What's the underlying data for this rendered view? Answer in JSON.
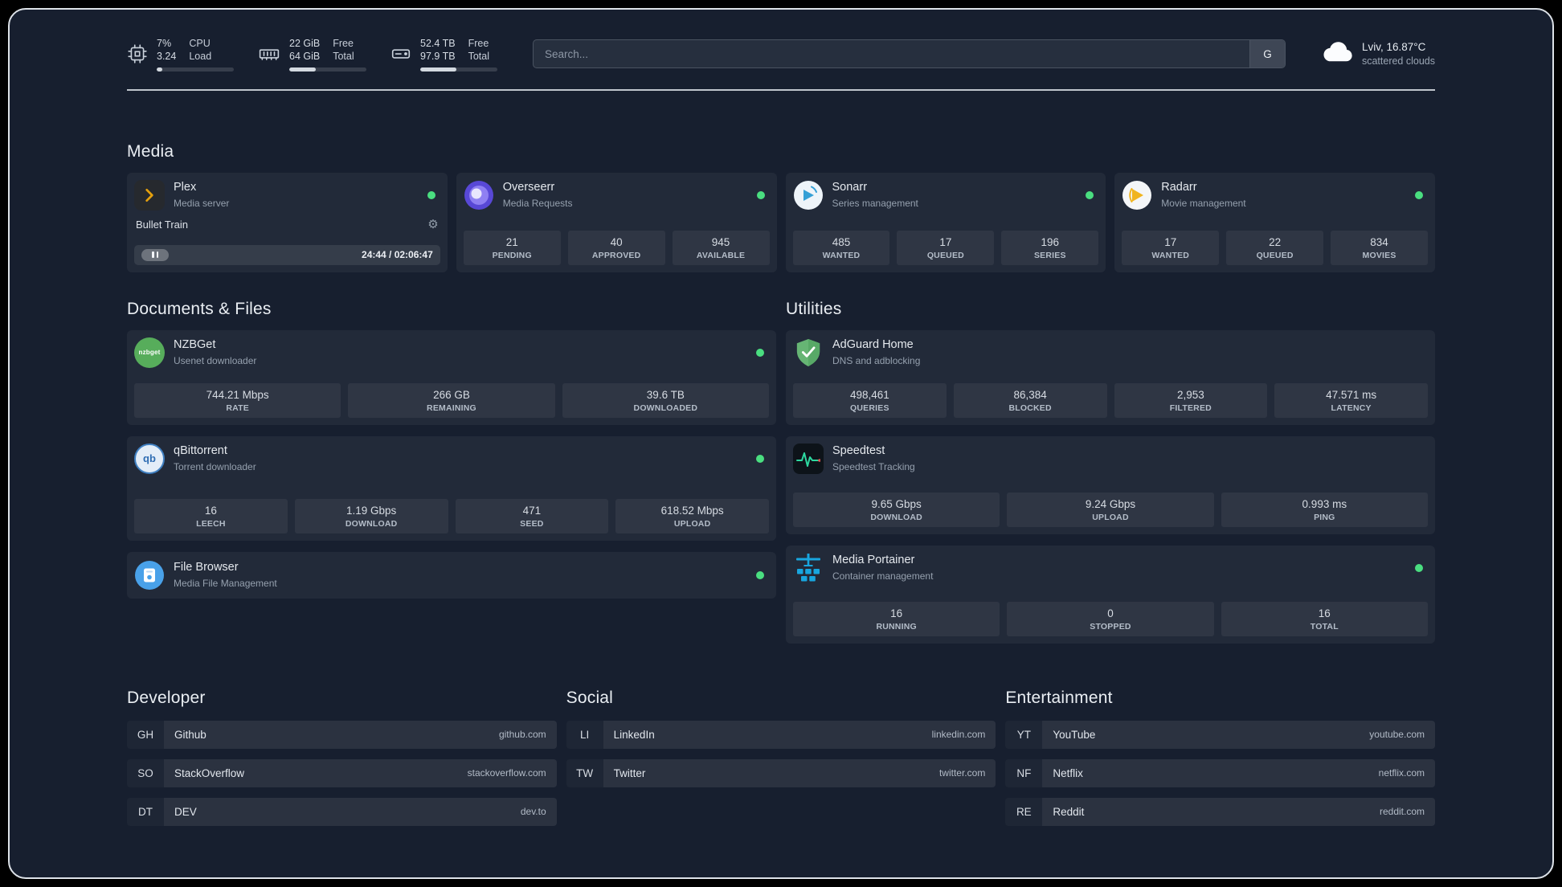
{
  "topbar": {
    "resources": [
      {
        "icon": "cpu-icon",
        "value_top": "7%",
        "value_bottom": "3.24",
        "label_top": "CPU",
        "label_bottom": "Load",
        "progress": "7%"
      },
      {
        "icon": "memory-icon",
        "value_top": "22 GiB",
        "value_bottom": "64 GiB",
        "label_top": "Free",
        "label_bottom": "Total",
        "progress": "34%"
      },
      {
        "icon": "disk-icon",
        "value_top": "52.4 TB",
        "value_bottom": "97.9 TB",
        "label_top": "Free",
        "label_bottom": "Total",
        "progress": "47%"
      }
    ],
    "search": {
      "placeholder": "Search...",
      "provider_button": "G"
    },
    "weather": {
      "location": "Lviv, 16.87°C",
      "condition": "scattered clouds"
    }
  },
  "sections": {
    "media": {
      "title": "Media",
      "plex": {
        "name": "Plex",
        "description": "Media server",
        "status": "online",
        "now_playing": "Bullet Train",
        "progress_time": "24:44 / 02:06:47"
      },
      "overseerr": {
        "name": "Overseerr",
        "description": "Media Requests",
        "status": "online",
        "stats": [
          {
            "value": "21",
            "label": "PENDING"
          },
          {
            "value": "40",
            "label": "APPROVED"
          },
          {
            "value": "945",
            "label": "AVAILABLE"
          }
        ]
      },
      "sonarr": {
        "name": "Sonarr",
        "description": "Series management",
        "status": "online",
        "stats": [
          {
            "value": "485",
            "label": "WANTED"
          },
          {
            "value": "17",
            "label": "QUEUED"
          },
          {
            "value": "196",
            "label": "SERIES"
          }
        ]
      },
      "radarr": {
        "name": "Radarr",
        "description": "Movie management",
        "status": "online",
        "stats": [
          {
            "value": "17",
            "label": "WANTED"
          },
          {
            "value": "22",
            "label": "QUEUED"
          },
          {
            "value": "834",
            "label": "MOVIES"
          }
        ]
      }
    },
    "documents": {
      "title": "Documents & Files",
      "nzbget": {
        "name": "NZBGet",
        "description": "Usenet downloader",
        "status": "online",
        "stats": [
          {
            "value": "744.21 Mbps",
            "label": "RATE"
          },
          {
            "value": "266 GB",
            "label": "REMAINING"
          },
          {
            "value": "39.6 TB",
            "label": "DOWNLOADED"
          }
        ]
      },
      "qbittorrent": {
        "name": "qBittorrent",
        "description": "Torrent downloader",
        "status": "online",
        "stats": [
          {
            "value": "16",
            "label": "LEECH"
          },
          {
            "value": "1.19 Gbps",
            "label": "DOWNLOAD"
          },
          {
            "value": "471",
            "label": "SEED"
          },
          {
            "value": "618.52 Mbps",
            "label": "UPLOAD"
          }
        ]
      },
      "filebrowser": {
        "name": "File Browser",
        "description": "Media File Management",
        "status": "online"
      }
    },
    "utilities": {
      "title": "Utilities",
      "adguard": {
        "name": "AdGuard Home",
        "description": "DNS and adblocking",
        "stats": [
          {
            "value": "498,461",
            "label": "QUERIES"
          },
          {
            "value": "86,384",
            "label": "BLOCKED"
          },
          {
            "value": "2,953",
            "label": "FILTERED"
          },
          {
            "value": "47.571 ms",
            "label": "LATENCY"
          }
        ]
      },
      "speedtest": {
        "name": "Speedtest",
        "description": "Speedtest Tracking",
        "stats": [
          {
            "value": "9.65 Gbps",
            "label": "DOWNLOAD"
          },
          {
            "value": "9.24 Gbps",
            "label": "UPLOAD"
          },
          {
            "value": "0.993 ms",
            "label": "PING"
          }
        ]
      },
      "portainer": {
        "name": "Media Portainer",
        "description": "Container management",
        "status": "online",
        "stats": [
          {
            "value": "16",
            "label": "RUNNING"
          },
          {
            "value": "0",
            "label": "STOPPED"
          },
          {
            "value": "16",
            "label": "TOTAL"
          }
        ]
      }
    }
  },
  "bookmarks": {
    "developer": {
      "title": "Developer",
      "items": [
        {
          "abbr": "GH",
          "name": "Github",
          "domain": "github.com"
        },
        {
          "abbr": "SO",
          "name": "StackOverflow",
          "domain": "stackoverflow.com"
        },
        {
          "abbr": "DT",
          "name": "DEV",
          "domain": "dev.to"
        }
      ]
    },
    "social": {
      "title": "Social",
      "items": [
        {
          "abbr": "LI",
          "name": "LinkedIn",
          "domain": "linkedin.com"
        },
        {
          "abbr": "TW",
          "name": "Twitter",
          "domain": "twitter.com"
        }
      ]
    },
    "entertainment": {
      "title": "Entertainment",
      "items": [
        {
          "abbr": "YT",
          "name": "YouTube",
          "domain": "youtube.com"
        },
        {
          "abbr": "NF",
          "name": "Netflix",
          "domain": "netflix.com"
        },
        {
          "abbr": "RE",
          "name": "Reddit",
          "domain": "reddit.com"
        }
      ]
    }
  },
  "colors": {
    "status_online": "#4ade80",
    "accent_plex": "#e5a00d",
    "background": "#171f2f"
  }
}
